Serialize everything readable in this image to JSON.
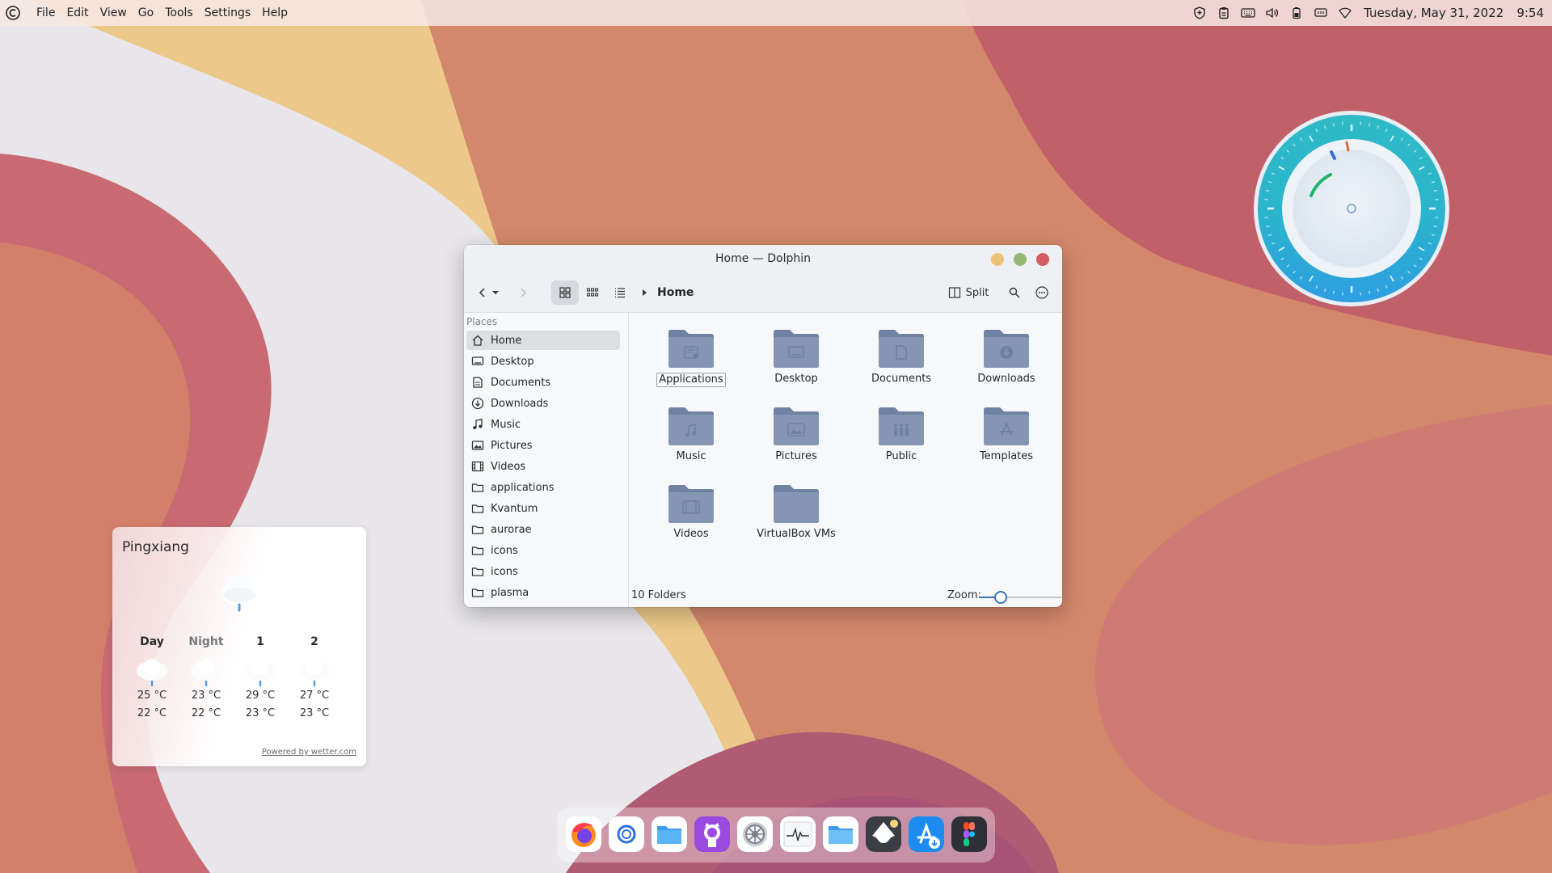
{
  "top_panel": {
    "menu": [
      "File",
      "Edit",
      "View",
      "Go",
      "Tools",
      "Settings",
      "Help"
    ],
    "tray_icons": [
      "shield-icon",
      "clipboard-icon",
      "keyboard-icon",
      "volume-icon",
      "battery-icon",
      "display-icon",
      "wifi-icon"
    ],
    "date": "Tuesday, May 31, 2022",
    "time": "9:54"
  },
  "weather": {
    "city": "Pingxiang",
    "current_icon": "rain-cloud-icon",
    "forecast": [
      {
        "label": "Day",
        "high": "25 °C",
        "low": "22 °C"
      },
      {
        "label": "Night",
        "high": "23 °C",
        "low": "22 °C"
      },
      {
        "label": "1",
        "high": "29 °C",
        "low": "23 °C"
      },
      {
        "label": "2",
        "high": "27 °C",
        "low": "23 °C"
      }
    ],
    "powered_by": "Powered by wetter.com"
  },
  "dolphin": {
    "title": "Home — Dolphin",
    "breadcrumb": "Home",
    "split_label": "Split",
    "places_header": "Places",
    "places": [
      {
        "label": "Home",
        "icon": "home-icon",
        "selected": true
      },
      {
        "label": "Desktop",
        "icon": "desktop-icon"
      },
      {
        "label": "Documents",
        "icon": "documents-icon"
      },
      {
        "label": "Downloads",
        "icon": "downloads-icon"
      },
      {
        "label": "Music",
        "icon": "music-icon"
      },
      {
        "label": "Pictures",
        "icon": "pictures-icon"
      },
      {
        "label": "Videos",
        "icon": "videos-icon"
      },
      {
        "label": "applications",
        "icon": "folder-icon"
      },
      {
        "label": "Kvantum",
        "icon": "folder-icon"
      },
      {
        "label": "aurorae",
        "icon": "folder-icon"
      },
      {
        "label": "icons",
        "icon": "folder-icon"
      },
      {
        "label": "icons",
        "icon": "folder-icon"
      },
      {
        "label": "plasma",
        "icon": "folder-icon"
      }
    ],
    "folders": [
      {
        "label": "Applications",
        "emblem": "applications",
        "focused": true
      },
      {
        "label": "Desktop",
        "emblem": "desktop"
      },
      {
        "label": "Documents",
        "emblem": "documents"
      },
      {
        "label": "Downloads",
        "emblem": "downloads"
      },
      {
        "label": "Music",
        "emblem": "music"
      },
      {
        "label": "Pictures",
        "emblem": "pictures"
      },
      {
        "label": "Public",
        "emblem": "public"
      },
      {
        "label": "Templates",
        "emblem": "templates"
      },
      {
        "label": "Videos",
        "emblem": "videos"
      },
      {
        "label": "VirtualBox VMs",
        "emblem": "none"
      }
    ],
    "status": "10 Folders",
    "zoom_label": "Zoom:",
    "zoom_value": 0.26
  },
  "dock": {
    "apps": [
      "firefox",
      "browser",
      "files",
      "github",
      "system-settings",
      "system-monitor",
      "files-2",
      "inkscape",
      "app-store",
      "figma"
    ]
  },
  "colors": {
    "folder": "#8496b4",
    "folder_dark": "#6f82a2",
    "accent": "#3a73b8",
    "clock_ring": "#2ab8c6",
    "clock_ring_bottom": "#2d9fe0"
  }
}
